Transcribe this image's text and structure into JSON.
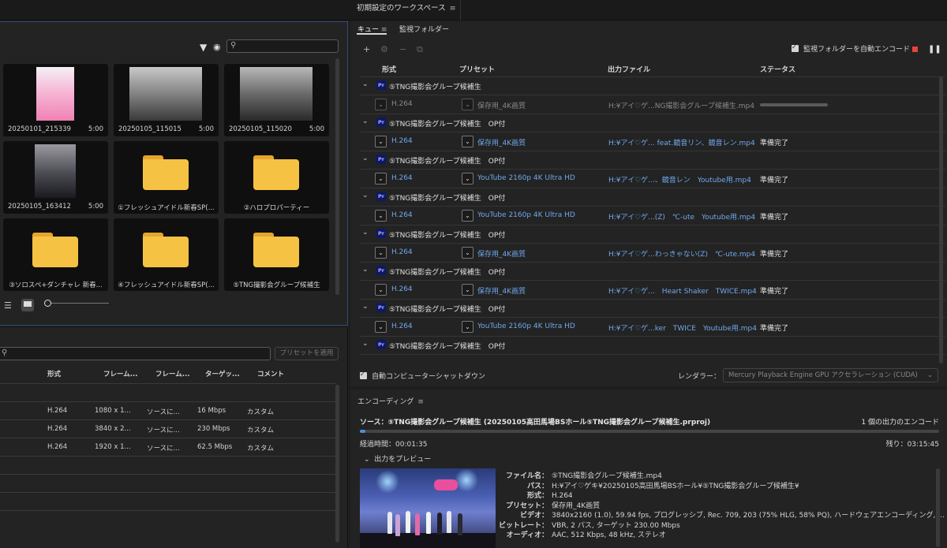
{
  "workspace": {
    "title": "初期設定のワークスペース",
    "menu_icon": "≡"
  },
  "media_browser": {
    "filter_icon": "funnel-icon",
    "eye_icon": "eye-icon",
    "search": {
      "placeholder": "",
      "value": ""
    },
    "items": [
      {
        "type": "video",
        "name": "20250101_215339",
        "duration": "5:00"
      },
      {
        "type": "video",
        "name": "20250105_115015",
        "duration": "5:00"
      },
      {
        "type": "video",
        "name": "20250105_115020",
        "duration": "5:00"
      },
      {
        "type": "video",
        "name": "20250105_163412",
        "duration": "5:00"
      },
      {
        "type": "folder",
        "name": "①フレッシュアイドル新春SP(..."
      },
      {
        "type": "folder",
        "name": "②ハロプロパーティー"
      },
      {
        "type": "folder",
        "name": "③ソロスペ+ダンチャレ 新春..."
      },
      {
        "type": "folder",
        "name": "④フレッシュアイドル新春SP(..."
      },
      {
        "type": "folder",
        "name": "⑤TNG撮影会グループ候補生"
      }
    ],
    "zoom_level": 0
  },
  "preset_browser": {
    "search": {
      "placeholder": "",
      "value": ""
    },
    "apply_label": "プリセットを適用",
    "columns": [
      "形式",
      "フレーム...",
      "フレーム...",
      "ターゲッ...",
      "コメント"
    ],
    "rows": [
      [
        "H.264",
        "1080 x 1...",
        "ソースに...",
        "16 Mbps",
        "カスタム"
      ],
      [
        "H.264",
        "3840 x 2...",
        "ソースに...",
        "230 Mbps",
        "カスタム"
      ],
      [
        "H.264",
        "1920 x 1...",
        "ソースに...",
        "62.5 Mbps",
        "カスタム"
      ]
    ]
  },
  "queue": {
    "tabs": [
      {
        "label": "キュー",
        "menu": "≡"
      },
      {
        "label": "監視フォルダー"
      }
    ],
    "toolbar": {
      "add": "+",
      "settings": "⚙",
      "remove": "−",
      "duplicate": "⧉"
    },
    "auto_encode_label": "監視フォルダーを自動エンコード",
    "columns": {
      "format": "形式",
      "preset": "プリセット",
      "output": "出力ファイル",
      "status": "ステータス"
    },
    "groups": [
      {
        "name": "⑤TNG撮影会グループ候補生",
        "item": {
          "format": "H.264",
          "preset": "保存用_4K画質",
          "output": "H:¥アイ♡ゲ...NG撮影会グループ候補生.mp4",
          "status": "",
          "progress": 0.55,
          "encoding": true
        }
      },
      {
        "name": "⑤TNG撮影会グループ候補生　OP付",
        "item": {
          "format": "H.264",
          "preset": "保存用_4K画質",
          "output": "H:¥アイ♡ゲ... feat.鏡音リン、鏡音レン.mp4",
          "status": "準備完了"
        }
      },
      {
        "name": "⑤TNG撮影会グループ候補生　OP付",
        "item": {
          "format": "H.264",
          "preset": "YouTube 2160p 4K Ultra HD",
          "output": "H:¥アイ♡ゲ...、鏡音レン　Youtube用.mp4",
          "status": "準備完了"
        }
      },
      {
        "name": "⑤TNG撮影会グループ候補生　OP付",
        "item": {
          "format": "H.264",
          "preset": "YouTube 2160p 4K Ultra HD",
          "output": "H:¥アイ♡ゲ...(Z)　℃-ute　Youtube用.mp4",
          "status": "準備完了"
        }
      },
      {
        "name": "⑤TNG撮影会グループ候補生　OP付",
        "item": {
          "format": "H.264",
          "preset": "保存用_4K画質",
          "output": "H:¥アイ♡ゲ...わっきゃない(Z)　℃-ute.mp4",
          "status": "準備完了"
        }
      },
      {
        "name": "⑤TNG撮影会グループ候補生　OP付",
        "item": {
          "format": "H.264",
          "preset": "保存用_4K画質",
          "output": "H:¥アイ♡ゲ...　Heart Shaker　TWICE.mp4",
          "status": "準備完了"
        }
      },
      {
        "name": "⑤TNG撮影会グループ候補生　OP付",
        "item": {
          "format": "H.264",
          "preset": "YouTube 2160p 4K Ultra HD",
          "output": "H:¥アイ♡ゲ...ker　TWICE　Youtube用.mp4",
          "status": "準備完了"
        }
      },
      {
        "name": "⑤TNG撮影会グループ候補生　OP付"
      }
    ],
    "shutdown_label": "自動コンピューターシャットダウン",
    "renderer_label": "レンダラー：",
    "renderer_value": "Mercury Playback Engine GPU アクセラレーション (CUDA)"
  },
  "encoding": {
    "title": "エンコーディング",
    "menu": "≡",
    "source": "ソース：⑤TNG撮影会グループ候補生 (20250105高田馬場BSホール⑤TNG撮影会グループ候補生.prproj)",
    "output_count": "1 個の出力のエンコード",
    "progress": 0.01,
    "elapsed": "経過時間：00:01:35",
    "remaining": "残り：03:15:45",
    "preview_label": "出力をプレビュー",
    "info": [
      {
        "k": "ファイル名：",
        "v": "⑤TNG撮影会グループ候補生.mp4"
      },
      {
        "k": "パス：",
        "v": "H:¥アイ♡ゲキ¥20250105高田馬場BSホール¥⑤TNG撮影会グループ候補生¥"
      },
      {
        "k": "形式：",
        "v": "H.264"
      },
      {
        "k": "プリセット：",
        "v": "保存用_4K画質"
      },
      {
        "k": "ビデオ：",
        "v": "3840x2160 (1.0), 59.94 fps, プログレッシブ, Rec. 709, 203 (75% HLG, 58% PQ), ハードウェアエンコーディング, ..."
      },
      {
        "k": "ビットレート：",
        "v": "VBR, 2 パス, ターゲット 230.00 Mbps"
      },
      {
        "k": "オーディオ：",
        "v": "AAC, 512 Kbps, 48 kHz, ステレオ"
      }
    ]
  }
}
